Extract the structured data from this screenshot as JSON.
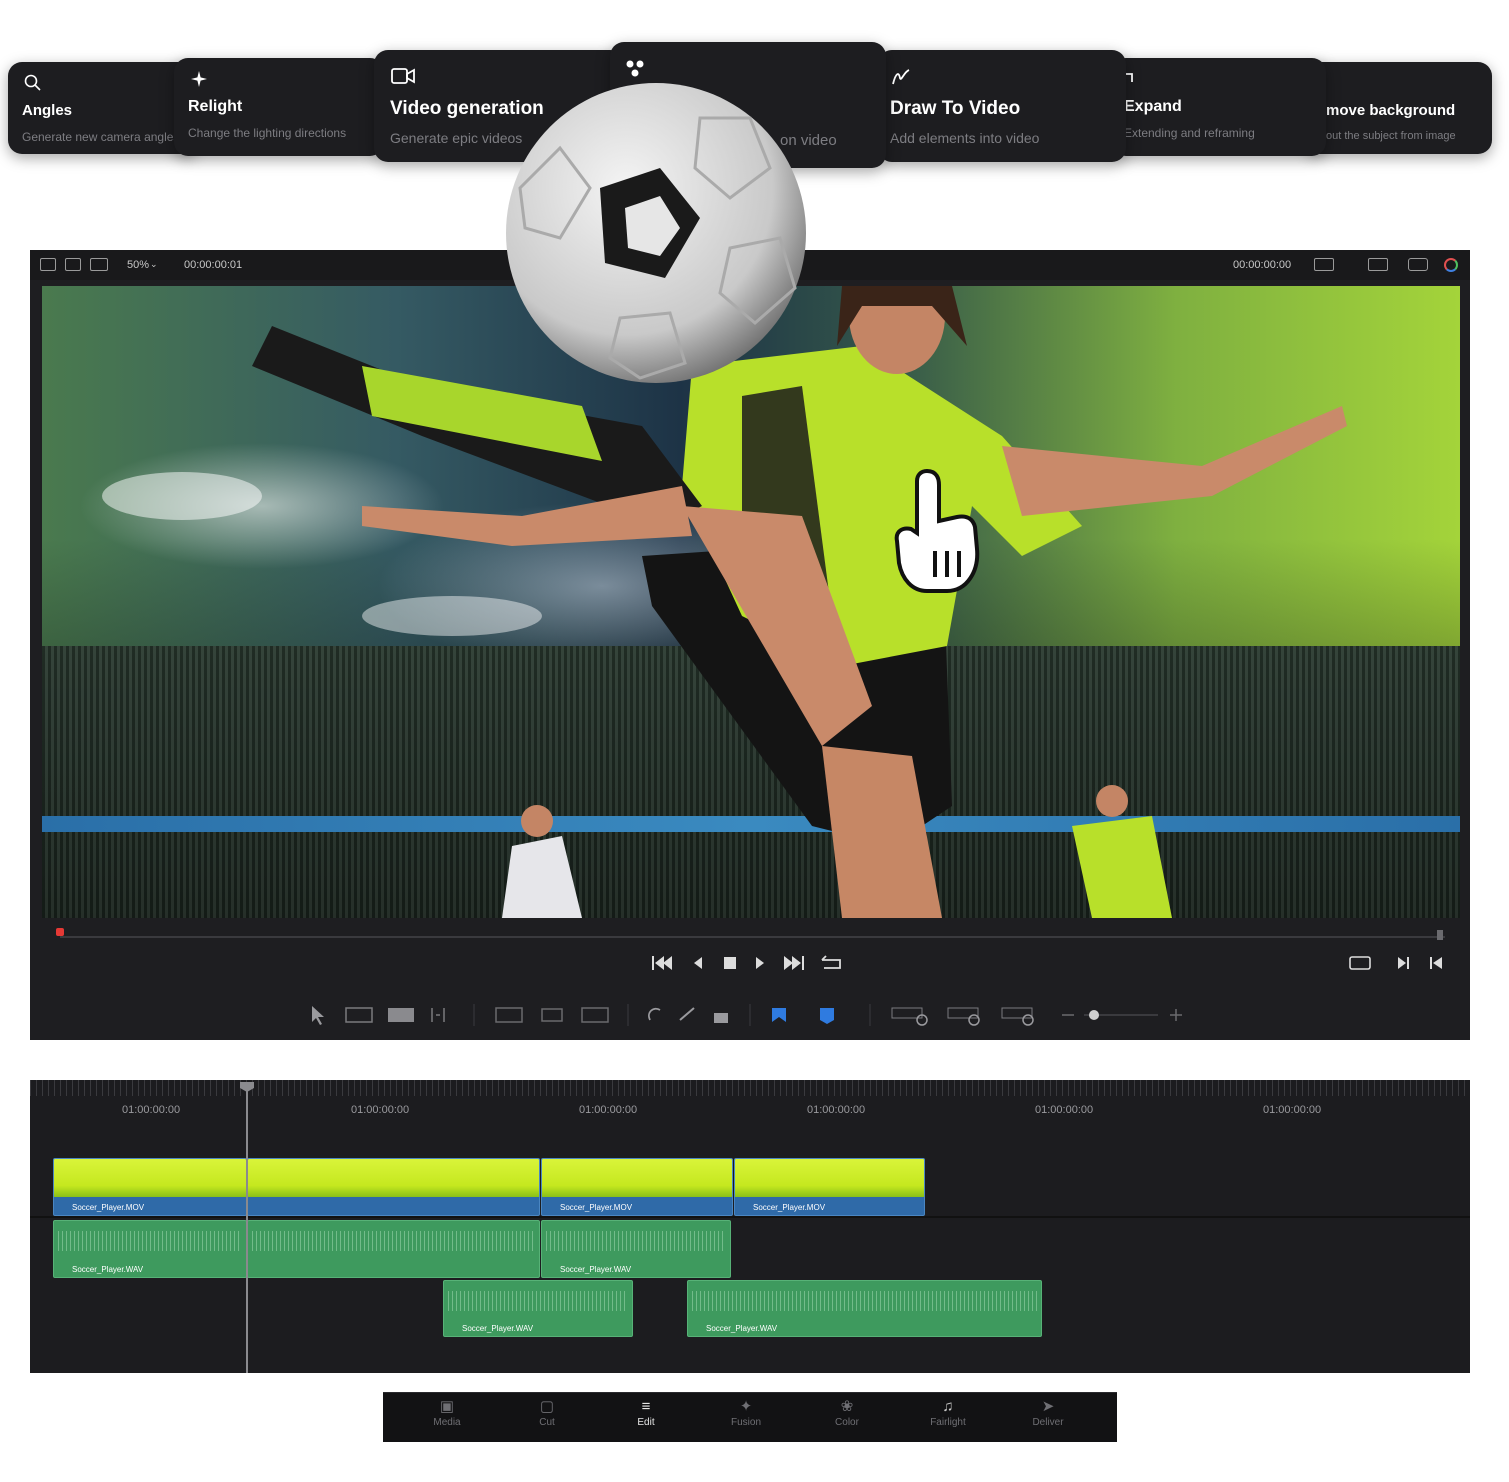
{
  "feature_cards": [
    {
      "title": "Angles",
      "subtitle": "Generate new camera angles",
      "icon": "search-icon"
    },
    {
      "title": "Relight",
      "subtitle": "Change the lighting directions",
      "icon": "sparkle-icon"
    },
    {
      "title": "Video generation",
      "subtitle": "Generate epic videos",
      "icon": "video-camera-icon"
    },
    {
      "title": "",
      "subtitle": "on video",
      "icon": "dots-icon"
    },
    {
      "title": "Draw To Video",
      "subtitle": "Add elements into video",
      "icon": "draw-icon"
    },
    {
      "title": "Expand",
      "subtitle": "Extending and reframing",
      "icon": "expand-icon"
    },
    {
      "title": "move background",
      "subtitle": "out the subject from image",
      "icon": ""
    }
  ],
  "viewer": {
    "zoom": "50%",
    "timecode_left": "00:00:00:01",
    "timecode_right": "00:00:00:00"
  },
  "timeline": {
    "timecodes": [
      "01:00:00:00",
      "01:00:00:00",
      "01:00:00:00",
      "01:00:00:00",
      "01:00:00:00",
      "01:00:00:00"
    ],
    "video_clip_label": "Soccer_Player.MOV",
    "audio_clip_label": "Soccer_Player.WAV"
  },
  "dock": [
    {
      "label": "Media",
      "icon": "media-icon"
    },
    {
      "label": "Cut",
      "icon": "cut-icon"
    },
    {
      "label": "Edit",
      "icon": "edit-icon",
      "active": true
    },
    {
      "label": "Fusion",
      "icon": "fusion-icon"
    },
    {
      "label": "Color",
      "icon": "color-icon"
    },
    {
      "label": "Fairlight",
      "icon": "music-note-icon"
    },
    {
      "label": "Deliver",
      "icon": "rocket-icon"
    }
  ],
  "colors": {
    "accent_green": "#c5e81f",
    "video_track": "#2f6aa8",
    "audio_track": "#3e9a5e",
    "playhead_marker": "#e53935"
  }
}
